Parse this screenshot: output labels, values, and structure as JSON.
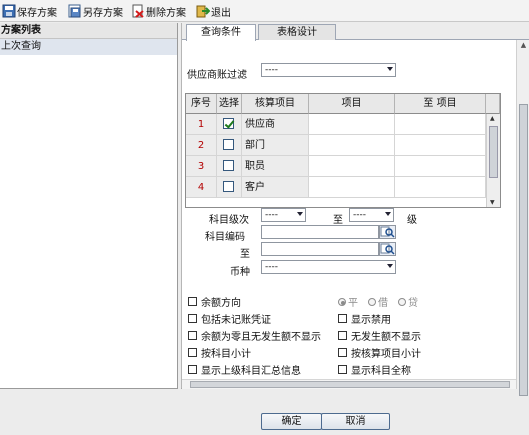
{
  "toolbar": {
    "save": "保存方案",
    "save_as": "另存方案",
    "delete": "删除方案",
    "exit": "退出"
  },
  "left_panel": {
    "title": "方案列表",
    "items": [
      "上次查询"
    ]
  },
  "tabs": [
    "查询条件",
    "表格设计"
  ],
  "supplier_filter": {
    "label": "供应商账过滤",
    "value": "----"
  },
  "grid": {
    "headers": [
      "序号",
      "选择",
      "核算项目",
      "项目",
      "至 项目"
    ],
    "rows": [
      {
        "num": "1",
        "checked": true,
        "item": "供应商"
      },
      {
        "num": "2",
        "checked": false,
        "item": "部门"
      },
      {
        "num": "3",
        "checked": false,
        "item": "职员"
      },
      {
        "num": "4",
        "checked": false,
        "item": "客户"
      }
    ]
  },
  "level": {
    "label": "科目级次",
    "from": "----",
    "to_label": "至",
    "to": "----",
    "unit": "级"
  },
  "account_code": {
    "label": "科目编码",
    "to_label": "至"
  },
  "currency": {
    "label": "币种",
    "value": "----"
  },
  "options": {
    "balance_direction": "余额方向",
    "include_unposted": "包括未记账凭证",
    "hide_zero_balance": "余额为零且无发生额不显示",
    "subtotal_by_account": "按科目小计",
    "show_parent_summary": "显示上级科目汇总信息",
    "show_disabled": "显示禁用",
    "hide_no_activity": "无发生额不显示",
    "subtotal_by_item": "按核算项目小计",
    "show_full_name": "显示科目全称"
  },
  "direction": {
    "flat": "平",
    "debit": "借",
    "credit": "贷"
  },
  "buttons": {
    "ok": "确定",
    "cancel": "取消"
  }
}
